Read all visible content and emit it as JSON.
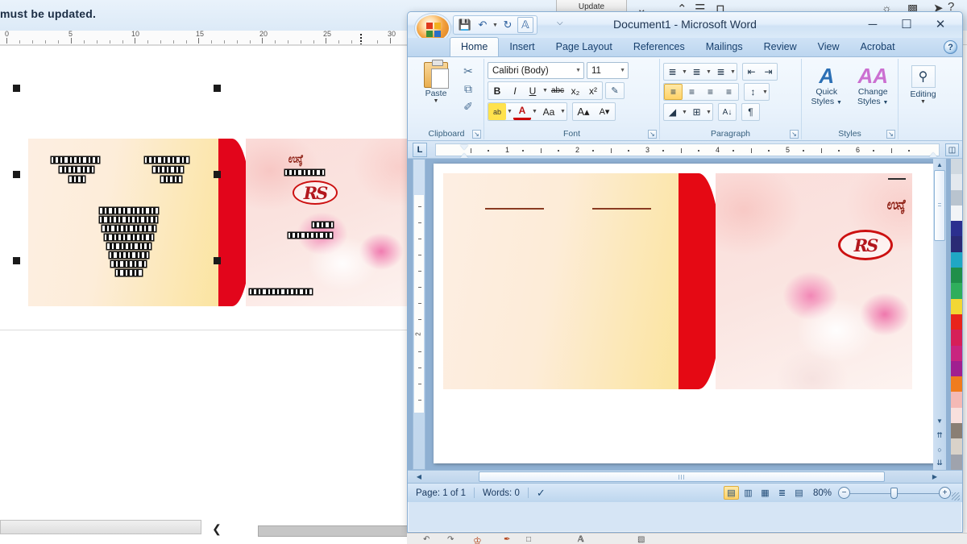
{
  "background_app": {
    "notice_text": "must be updated.",
    "update_button_label": "Update",
    "ruler_numbers": [
      "0",
      "5",
      "10",
      "15",
      "20",
      "25",
      "30"
    ],
    "top_icons": [
      "chevron-down",
      "caret-up",
      "lines",
      "bridge"
    ],
    "right_icons": [
      "camera",
      "picture",
      "pointer",
      "help"
    ]
  },
  "word": {
    "titlebar": {
      "title": "Document1 - Microsoft Word",
      "office_button": "office-orb",
      "quick_access": [
        {
          "name": "save",
          "glyph": "💾"
        },
        {
          "name": "undo",
          "glyph": "↶"
        },
        {
          "name": "redo",
          "glyph": "↻"
        },
        {
          "name": "format-painter",
          "glyph": "A"
        }
      ],
      "customize_glyph": "⌵",
      "minimize": "─",
      "maximize": "☐",
      "close": "✕"
    },
    "tabs": [
      {
        "label": "Home",
        "active": true
      },
      {
        "label": "Insert",
        "active": false
      },
      {
        "label": "Page Layout",
        "active": false
      },
      {
        "label": "References",
        "active": false
      },
      {
        "label": "Mailings",
        "active": false
      },
      {
        "label": "Review",
        "active": false
      },
      {
        "label": "View",
        "active": false
      },
      {
        "label": "Acrobat",
        "active": false
      }
    ],
    "help_label": "?",
    "ribbon": {
      "clipboard": {
        "label": "Clipboard",
        "paste_label": "Paste",
        "cut_glyph": "✂",
        "copy_glyph": "⧉",
        "painter_glyph": "✐"
      },
      "font": {
        "label": "Font",
        "font_name": "Calibri (Body)",
        "font_size": "11",
        "bold": "B",
        "italic": "I",
        "underline": "U",
        "strikethrough": "abc",
        "subscript": "x₂",
        "superscript": "x²",
        "clear_formatting": "ᴀ",
        "highlight": "ab",
        "font_color": "A",
        "change_case": "Aa",
        "grow_font": "A▴",
        "shrink_font": "A▾"
      },
      "paragraph": {
        "label": "Paragraph",
        "bullets": "≣",
        "numbering": "≣",
        "multilevel": "≣",
        "decrease_indent": "⇤",
        "increase_indent": "⇥",
        "align_left": "≡",
        "align_center": "≡",
        "align_right": "≡",
        "justify": "≡",
        "line_spacing": "↕",
        "shading": "◢",
        "borders": "⊞",
        "sort": "A↓",
        "show_marks": "¶"
      },
      "styles": {
        "label": "Styles",
        "quick_styles_line1": "Quick",
        "quick_styles_line2": "Styles",
        "change_styles_line1": "Change",
        "change_styles_line2": "Styles",
        "glyph_a": "A",
        "glyph_aa": "AA"
      },
      "editing": {
        "label": "Editing",
        "editing_label": "Editing",
        "find_glyph": "⚲"
      }
    },
    "ruler": {
      "tab_selector": "L",
      "numbers": [
        "1",
        "2",
        "3",
        "4",
        "5",
        "6"
      ]
    },
    "vertical_ruler_numbers": [
      "2"
    ],
    "document": {
      "card": {
        "script_text": "ಉನ್ಕೆ",
        "logo_text": "RS",
        "line_count": 2
      }
    },
    "statusbar": {
      "page_label": "Page: 1 of 1",
      "words_label": "Words: 0",
      "proofing_glyph": "✓",
      "zoom_label": "80%",
      "zoom_out": "−",
      "zoom_in": "+",
      "views": [
        {
          "name": "print-layout",
          "glyph": "▤",
          "active": true
        },
        {
          "name": "full-screen-reading",
          "glyph": "▥",
          "active": false
        },
        {
          "name": "web-layout",
          "glyph": "▦",
          "active": false
        },
        {
          "name": "outline",
          "glyph": "≣",
          "active": false
        },
        {
          "name": "draft",
          "glyph": "▤",
          "active": false
        }
      ]
    },
    "scroll": {
      "up_arrow": "▲",
      "down_arrow": "▼",
      "prev_page": "⇈",
      "select_object": "○",
      "next_page": "⇊",
      "left_arrow": "◀",
      "right_arrow": "▶"
    }
  },
  "colors": {
    "card_red": "#e50914",
    "card_cream": "#fdeee3",
    "card_yellow": "#fbe49c",
    "logo_red": "#b3171d",
    "ribbon_blue": "#dfecf9",
    "tab_active": "#fdfefe",
    "highlight_orange": "#ffd267"
  }
}
